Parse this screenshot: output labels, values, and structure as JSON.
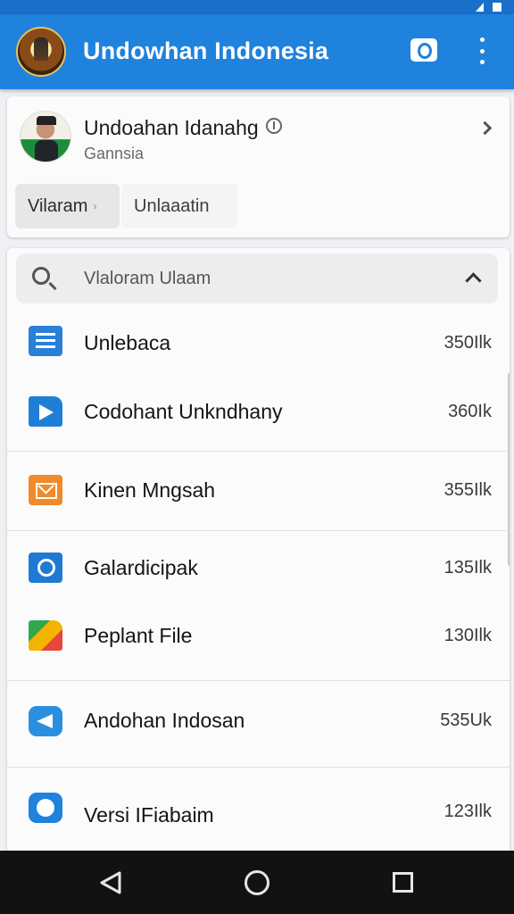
{
  "app_bar": {
    "title": "Undowhan Indonesia",
    "color": "#1f82dd"
  },
  "profile": {
    "name": "Undoahan Idanahg",
    "subtitle": "Gannsia",
    "chips": [
      {
        "label": "Vilaram"
      },
      {
        "label": "Unlaaatin"
      }
    ]
  },
  "search": {
    "text": "Vlaloram Ulaam"
  },
  "items": [
    {
      "label": "Unlebaca",
      "size": "350Ilk",
      "icon": "list-icon"
    },
    {
      "label": "Codohant Unkndhany",
      "size": "360Ik",
      "icon": "play-icon"
    },
    {
      "label": "Kinen Mngsah",
      "size": "355Ilk",
      "icon": "mail-icon"
    },
    {
      "label": "Galardicipak",
      "size": "135Ilk",
      "icon": "sync-icon"
    },
    {
      "label": "Peplant File",
      "size": "130Ilk",
      "icon": "folder-icon"
    },
    {
      "label": "Andohan Indosan",
      "size": "535Uk",
      "icon": "telegram-icon"
    },
    {
      "label": "Versi IFiabaim",
      "size": "123Ilk",
      "icon": "circle-icon"
    }
  ]
}
